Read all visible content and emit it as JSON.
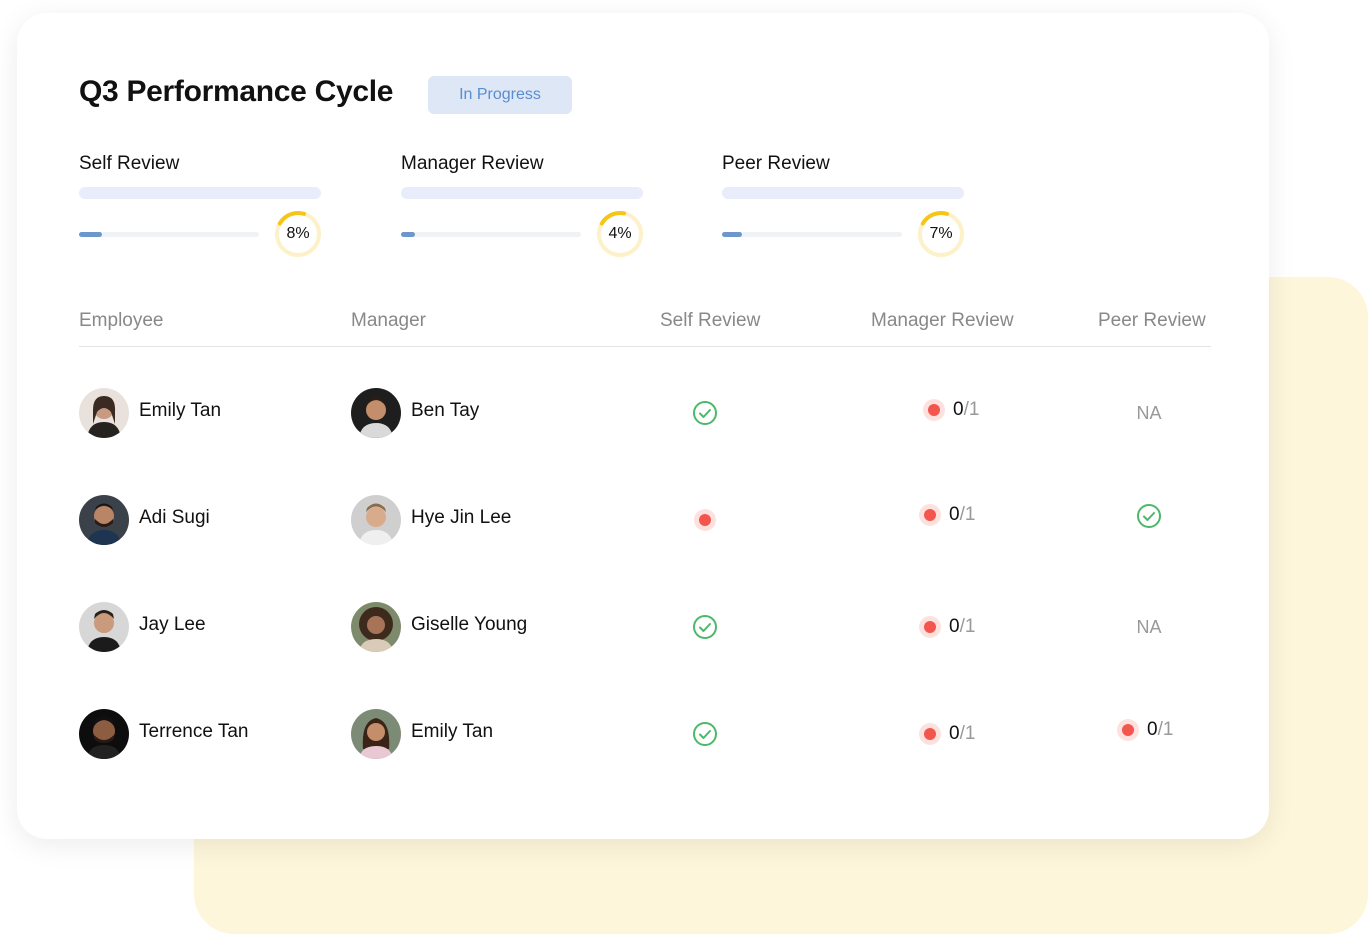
{
  "title": "Q3 Performance Cycle",
  "status_badge": "In Progress",
  "metrics": [
    {
      "label": "Self Review",
      "percent_text": "8%",
      "progress": 0.08
    },
    {
      "label": "Manager Review",
      "percent_text": "4%",
      "progress": 0.04
    },
    {
      "label": "Peer Review",
      "percent_text": "7%",
      "progress": 0.07
    }
  ],
  "table": {
    "headers": [
      "Employee",
      "Manager",
      "Self Review",
      "Manager Review",
      "Peer Review"
    ],
    "rows": [
      {
        "employee": "Emily Tan",
        "manager": "Ben Tay",
        "self": "done",
        "manager_review": {
          "num": "0",
          "den": "/1"
        },
        "peer": "NA"
      },
      {
        "employee": "Adi Sugi",
        "manager": "Hye Jin Lee",
        "self": "pending",
        "manager_review": {
          "num": "0",
          "den": "/1"
        },
        "peer": "done"
      },
      {
        "employee": "Jay Lee",
        "manager": "Giselle Young",
        "self": "done",
        "manager_review": {
          "num": "0",
          "den": "/1"
        },
        "peer": "NA"
      },
      {
        "employee": "Terrence Tan",
        "manager": "Emily Tan",
        "self": "done",
        "manager_review": {
          "num": "0",
          "den": "/1"
        },
        "peer_frac": {
          "num": "0",
          "den": "/1"
        }
      }
    ]
  },
  "colors": {
    "accent_blue": "#6c97cc",
    "ring_yellow": "#f5c518",
    "check_green": "#4cb86a",
    "pending_red": "#f2564d",
    "backdrop_yellow": "#fef6da"
  }
}
